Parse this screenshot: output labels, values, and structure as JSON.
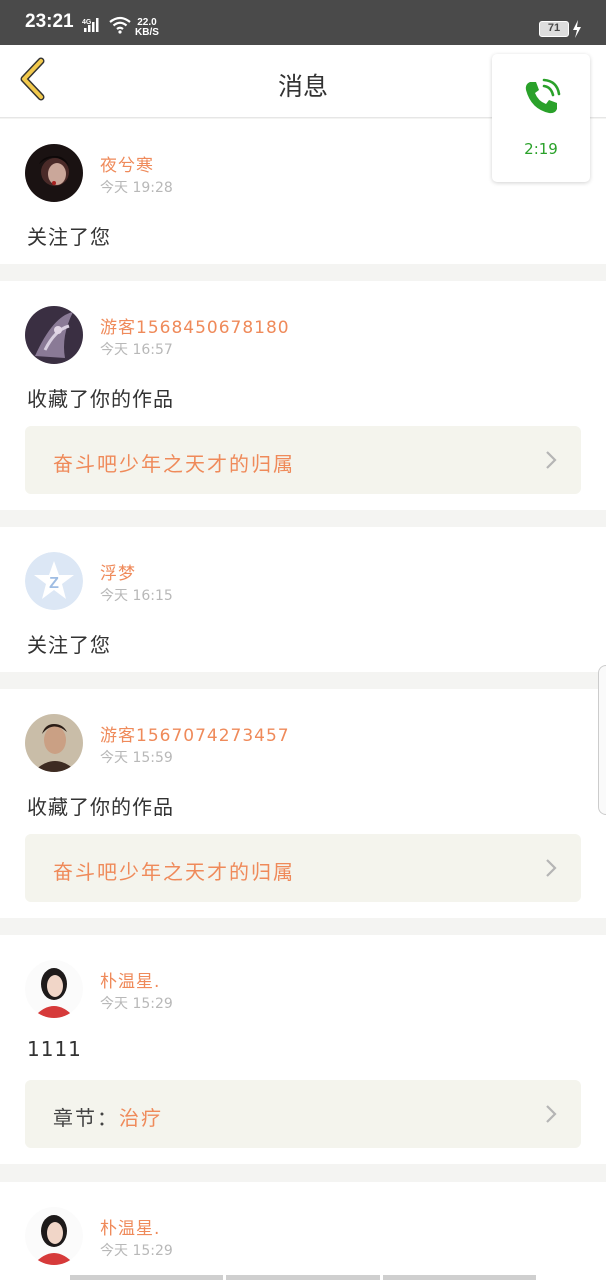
{
  "status_bar": {
    "time": "23:21",
    "network_type": "4G",
    "net_speed_value": "22.0",
    "net_speed_unit": "KB/S",
    "battery": "71"
  },
  "header": {
    "title": "消息",
    "back_icon": "chevron-left-icon"
  },
  "call_widget": {
    "icon": "phone-icon",
    "duration": "2:19"
  },
  "colors": {
    "accent": "#ef8a5a",
    "call_green": "#2aa12a",
    "back_yellow": "#f2c94c"
  },
  "messages": [
    {
      "user": "夜兮寒",
      "time": "今天 19:28",
      "action": "关注了您",
      "work": null
    },
    {
      "user": "游客1568450678180",
      "time": "今天 16:57",
      "action": "收藏了你的作品",
      "work": {
        "prefix": "",
        "title": "奋斗吧少年之天才的归属"
      }
    },
    {
      "user": "浮梦",
      "time": "今天 16:15",
      "action": "关注了您",
      "work": null
    },
    {
      "user": "游客1567074273457",
      "time": "今天 15:59",
      "action": "收藏了你的作品",
      "work": {
        "prefix": "",
        "title": "奋斗吧少年之天才的归属"
      }
    },
    {
      "user": "朴温星.",
      "time": "今天 15:29",
      "action": "1111",
      "work": {
        "prefix": "章节：",
        "title": "治疗"
      }
    },
    {
      "user": "朴温星.",
      "time": "今天 15:29",
      "action": "",
      "work": null
    }
  ]
}
